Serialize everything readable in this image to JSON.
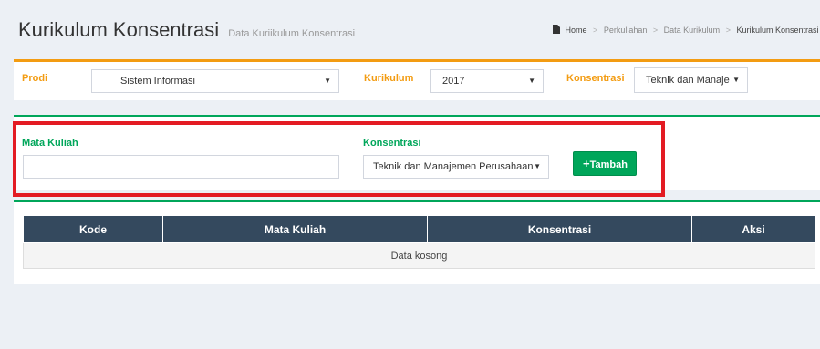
{
  "header": {
    "title": "Kurikulum Konsentrasi",
    "subtitle": "Data Kuriikulum Konsentrasi",
    "breadcrumb": [
      "Home",
      "Perkuliahan",
      "Data Kurikulum",
      "Kurikulum Konsentrasi"
    ],
    "breadcrumb_icon": "document-icon"
  },
  "filters": {
    "prodi": {
      "label": "Prodi",
      "value": "Sistem Informasi"
    },
    "kurikulum": {
      "label": "Kurikulum",
      "value": "2017"
    },
    "konsentrasi": {
      "label": "Konsentrasi",
      "value": "Teknik dan Manaje"
    }
  },
  "form": {
    "mata_kuliah": {
      "label": "Mata Kuliah",
      "value": ""
    },
    "konsentrasi": {
      "label": "Konsentrasi",
      "value": "Teknik dan Manajemen Perusahaan"
    },
    "add_button": {
      "icon": "+",
      "label": "Tambah"
    }
  },
  "table": {
    "columns": [
      "Kode",
      "Mata Kuliah",
      "Konsentrasi",
      "Aksi"
    ],
    "empty_text": "Data kosong"
  },
  "colors": {
    "filter_accent": "#f39c12",
    "form_accent": "#00a65a",
    "table_header": "#34495e",
    "highlight": "#e31b23"
  }
}
